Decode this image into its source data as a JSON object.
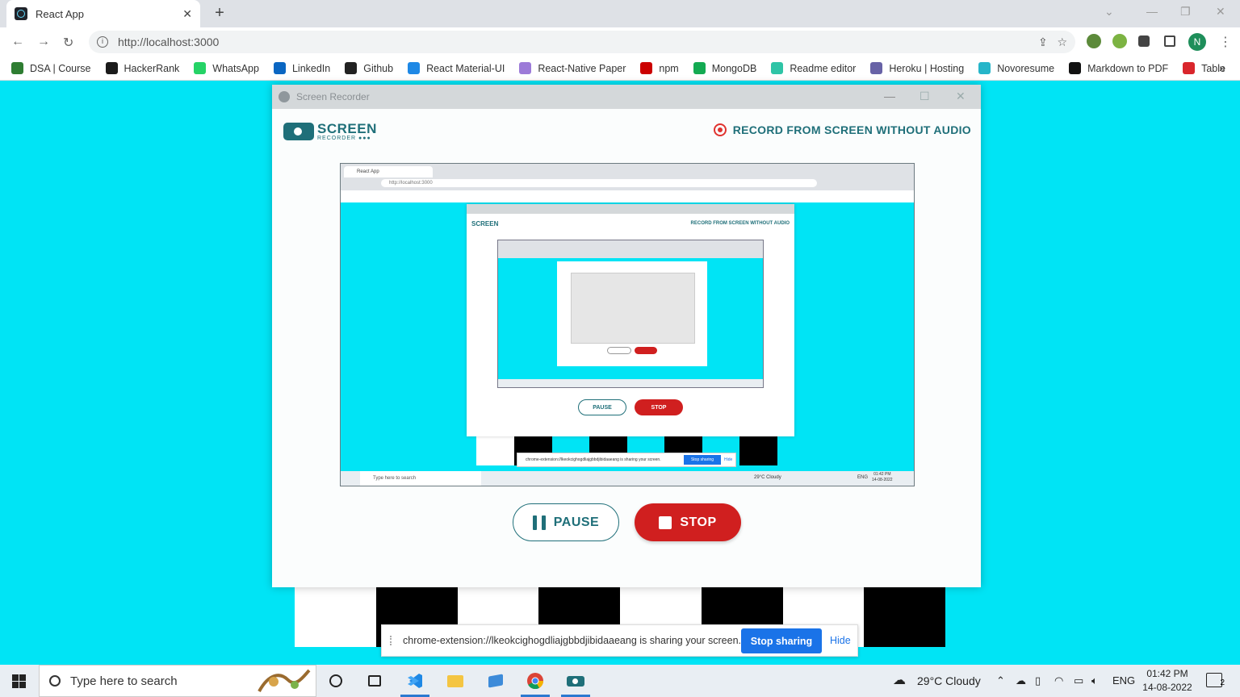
{
  "browser": {
    "tab_title": "React App",
    "tab_close": "✕",
    "new_tab": "+",
    "url": "http://localhost:3000",
    "avatar_initial": "N",
    "bookmarks": [
      {
        "label": "DSA | Course",
        "color": "#2e7d32"
      },
      {
        "label": "HackerRank",
        "color": "#1b1b1b"
      },
      {
        "label": "WhatsApp",
        "color": "#25d366"
      },
      {
        "label": "LinkedIn",
        "color": "#0a66c2"
      },
      {
        "label": "Github",
        "color": "#222222"
      },
      {
        "label": "React Material-UI",
        "color": "#1e88e5"
      },
      {
        "label": "React-Native Paper",
        "color": "#9c7ad8"
      },
      {
        "label": "npm",
        "color": "#cb0000"
      },
      {
        "label": "MongoDB",
        "color": "#13aa52"
      },
      {
        "label": "Readme editor",
        "color": "#2ec4a6"
      },
      {
        "label": "Heroku | Hosting",
        "color": "#6762a6"
      },
      {
        "label": "Novoresume",
        "color": "#26b5c9"
      },
      {
        "label": "Markdown to PDF",
        "color": "#111111"
      },
      {
        "label": "Table",
        "color": "#d9262c"
      }
    ],
    "bookmarks_more": "»"
  },
  "app_window": {
    "title": "Screen Recorder",
    "logo_main": "SCREEN",
    "logo_sub": "RECORDER ●●●",
    "record_label": "RECORD FROM SCREEN WITHOUT AUDIO",
    "pause_label": "PAUSE",
    "stop_label": "STOP"
  },
  "preview": {
    "tab_title": "React App",
    "url": "http://localhost:3000",
    "record_label": "RECORD FROM SCREEN WITHOUT AUDIO",
    "logo_main": "SCREEN",
    "pause_label": "PAUSE",
    "stop_label": "STOP",
    "share_text": "chrome-extension://lkeokcighogdliajgbbdjibidaaeang is sharing your screen.",
    "stop_sharing": "Stop sharing",
    "hide": "Hide",
    "search": "Type here to search",
    "weather": "29°C Cloudy",
    "lang": "ENG",
    "time": "01:42 PM",
    "date": "14-08-2022"
  },
  "sharing_bar": {
    "message": "chrome-extension://lkeokcighogdliajgbbdjibidaaeang is sharing your screen.",
    "stop_label": "Stop sharing",
    "hide_label": "Hide"
  },
  "taskbar": {
    "search_placeholder": "Type here to search",
    "weather": "29°C  Cloudy",
    "language": "ENG",
    "time": "01:42 PM",
    "date": "14-08-2022",
    "notification_count": "2"
  }
}
